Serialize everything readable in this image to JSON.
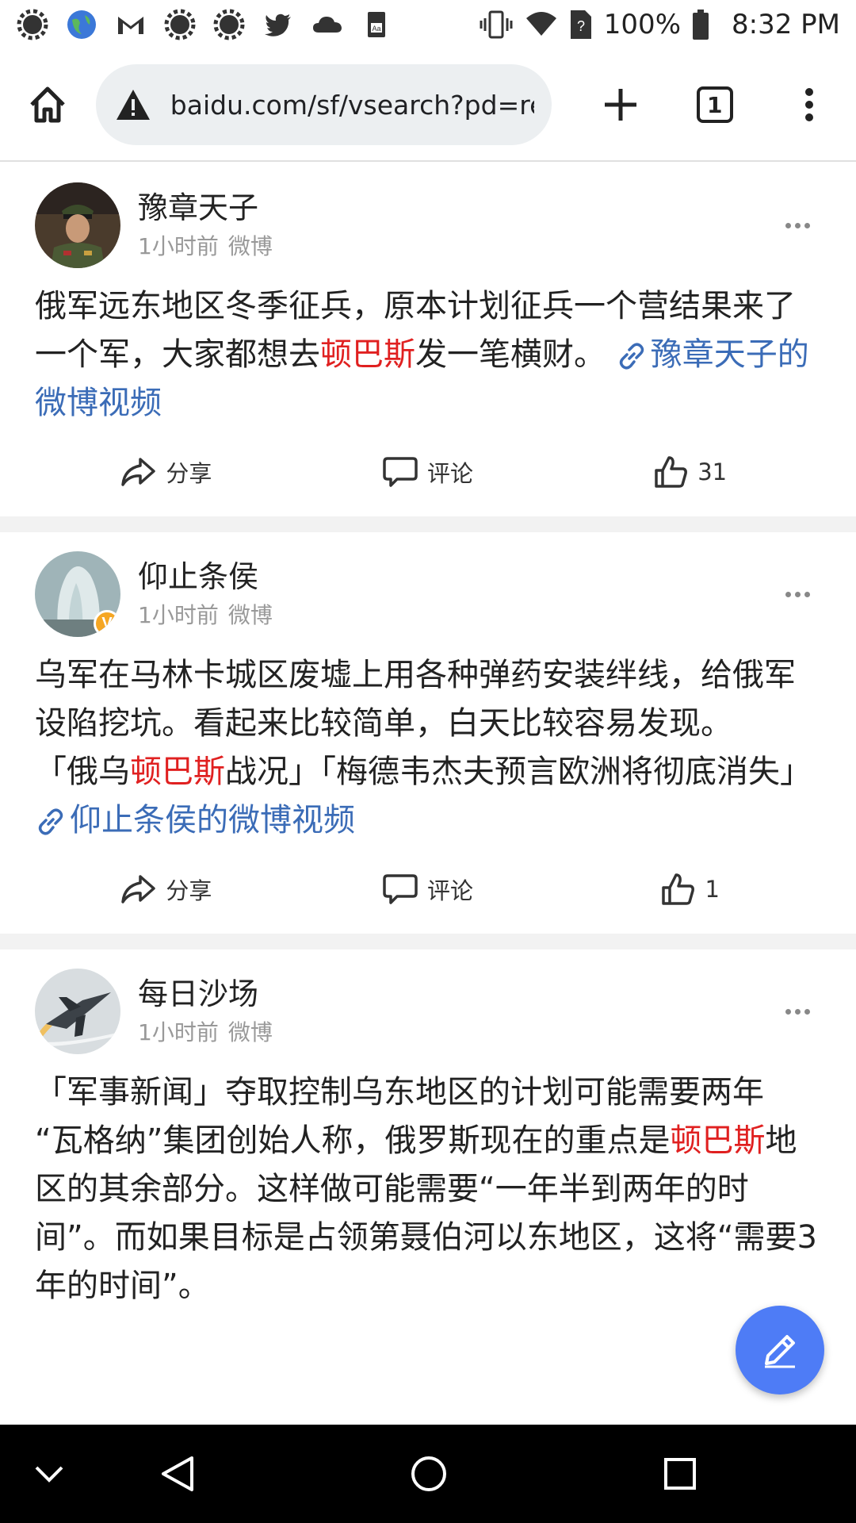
{
  "status_bar": {
    "icons_left": [
      "settings-icon",
      "globe-icon",
      "gmail-icon",
      "settings-icon",
      "settings-icon",
      "twitter-icon",
      "cloud-icon",
      "dictionary-icon"
    ],
    "battery": "100%",
    "time": "8:32 PM"
  },
  "browser": {
    "url": "baidu.com/sf/vsearch?pd=rea",
    "tab_count": "1"
  },
  "posts": [
    {
      "author": "豫章天子",
      "time": "1小时前",
      "source": "微博",
      "body_before": "俄军远东地区冬季征兵，原本计划征兵一个营结果来了一个军，大家都想去",
      "highlight": "顿巴斯",
      "body_after": "发一笔横财。",
      "link": "豫章天子的微博视频",
      "share": "分享",
      "comment": "评论",
      "likes": "31"
    },
    {
      "author": "仰止条侯",
      "time": "1小时前",
      "source": "微博",
      "badge": "V",
      "body_line1": "乌军在马林卡城区废墟上用各种弹药安装绊线，给俄军设陷挖坑。看起来比较简单，白天比较容易发现。",
      "body_before": "「俄乌",
      "highlight": "顿巴斯",
      "body_after": "战况」「梅德韦杰夫预言欧洲将彻底消失」",
      "link": "仰止条侯的微博视频",
      "share": "分享",
      "comment": "评论",
      "likes": "1"
    },
    {
      "author": "每日沙场",
      "time": "1小时前",
      "source": "微博",
      "body_line1": "「军事新闻」夺取控制乌东地区的计划可能需要两年",
      "body_before": "“瓦格纳”集团创始人称，俄罗斯现在的重点是",
      "highlight": "顿巴斯",
      "body_after": "地区的其余部分。这样做可能需要“一年半到两年的时间”。而如果目标是占领第聂伯河以东地区，这将“需要3年的时间”。"
    }
  ],
  "colors": {
    "highlight": "#e02020",
    "link": "#3b6cb7",
    "fab": "#4e7cf6"
  }
}
